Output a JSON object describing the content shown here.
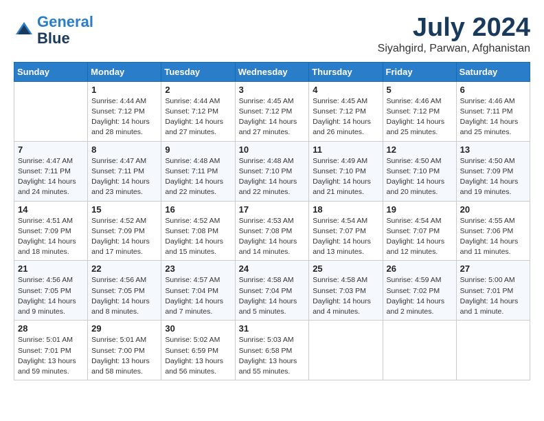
{
  "header": {
    "logo_line1": "General",
    "logo_line2": "Blue",
    "month_year": "July 2024",
    "location": "Siyahgird, Parwan, Afghanistan"
  },
  "weekdays": [
    "Sunday",
    "Monday",
    "Tuesday",
    "Wednesday",
    "Thursday",
    "Friday",
    "Saturday"
  ],
  "weeks": [
    [
      {
        "day": null,
        "info": null
      },
      {
        "day": "1",
        "info": "Sunrise: 4:44 AM\nSunset: 7:12 PM\nDaylight: 14 hours\nand 28 minutes."
      },
      {
        "day": "2",
        "info": "Sunrise: 4:44 AM\nSunset: 7:12 PM\nDaylight: 14 hours\nand 27 minutes."
      },
      {
        "day": "3",
        "info": "Sunrise: 4:45 AM\nSunset: 7:12 PM\nDaylight: 14 hours\nand 27 minutes."
      },
      {
        "day": "4",
        "info": "Sunrise: 4:45 AM\nSunset: 7:12 PM\nDaylight: 14 hours\nand 26 minutes."
      },
      {
        "day": "5",
        "info": "Sunrise: 4:46 AM\nSunset: 7:12 PM\nDaylight: 14 hours\nand 25 minutes."
      },
      {
        "day": "6",
        "info": "Sunrise: 4:46 AM\nSunset: 7:11 PM\nDaylight: 14 hours\nand 25 minutes."
      }
    ],
    [
      {
        "day": "7",
        "info": "Sunrise: 4:47 AM\nSunset: 7:11 PM\nDaylight: 14 hours\nand 24 minutes."
      },
      {
        "day": "8",
        "info": "Sunrise: 4:47 AM\nSunset: 7:11 PM\nDaylight: 14 hours\nand 23 minutes."
      },
      {
        "day": "9",
        "info": "Sunrise: 4:48 AM\nSunset: 7:11 PM\nDaylight: 14 hours\nand 22 minutes."
      },
      {
        "day": "10",
        "info": "Sunrise: 4:48 AM\nSunset: 7:10 PM\nDaylight: 14 hours\nand 22 minutes."
      },
      {
        "day": "11",
        "info": "Sunrise: 4:49 AM\nSunset: 7:10 PM\nDaylight: 14 hours\nand 21 minutes."
      },
      {
        "day": "12",
        "info": "Sunrise: 4:50 AM\nSunset: 7:10 PM\nDaylight: 14 hours\nand 20 minutes."
      },
      {
        "day": "13",
        "info": "Sunrise: 4:50 AM\nSunset: 7:09 PM\nDaylight: 14 hours\nand 19 minutes."
      }
    ],
    [
      {
        "day": "14",
        "info": "Sunrise: 4:51 AM\nSunset: 7:09 PM\nDaylight: 14 hours\nand 18 minutes."
      },
      {
        "day": "15",
        "info": "Sunrise: 4:52 AM\nSunset: 7:09 PM\nDaylight: 14 hours\nand 17 minutes."
      },
      {
        "day": "16",
        "info": "Sunrise: 4:52 AM\nSunset: 7:08 PM\nDaylight: 14 hours\nand 15 minutes."
      },
      {
        "day": "17",
        "info": "Sunrise: 4:53 AM\nSunset: 7:08 PM\nDaylight: 14 hours\nand 14 minutes."
      },
      {
        "day": "18",
        "info": "Sunrise: 4:54 AM\nSunset: 7:07 PM\nDaylight: 14 hours\nand 13 minutes."
      },
      {
        "day": "19",
        "info": "Sunrise: 4:54 AM\nSunset: 7:07 PM\nDaylight: 14 hours\nand 12 minutes."
      },
      {
        "day": "20",
        "info": "Sunrise: 4:55 AM\nSunset: 7:06 PM\nDaylight: 14 hours\nand 11 minutes."
      }
    ],
    [
      {
        "day": "21",
        "info": "Sunrise: 4:56 AM\nSunset: 7:05 PM\nDaylight: 14 hours\nand 9 minutes."
      },
      {
        "day": "22",
        "info": "Sunrise: 4:56 AM\nSunset: 7:05 PM\nDaylight: 14 hours\nand 8 minutes."
      },
      {
        "day": "23",
        "info": "Sunrise: 4:57 AM\nSunset: 7:04 PM\nDaylight: 14 hours\nand 7 minutes."
      },
      {
        "day": "24",
        "info": "Sunrise: 4:58 AM\nSunset: 7:04 PM\nDaylight: 14 hours\nand 5 minutes."
      },
      {
        "day": "25",
        "info": "Sunrise: 4:58 AM\nSunset: 7:03 PM\nDaylight: 14 hours\nand 4 minutes."
      },
      {
        "day": "26",
        "info": "Sunrise: 4:59 AM\nSunset: 7:02 PM\nDaylight: 14 hours\nand 2 minutes."
      },
      {
        "day": "27",
        "info": "Sunrise: 5:00 AM\nSunset: 7:01 PM\nDaylight: 14 hours\nand 1 minute."
      }
    ],
    [
      {
        "day": "28",
        "info": "Sunrise: 5:01 AM\nSunset: 7:01 PM\nDaylight: 13 hours\nand 59 minutes."
      },
      {
        "day": "29",
        "info": "Sunrise: 5:01 AM\nSunset: 7:00 PM\nDaylight: 13 hours\nand 58 minutes."
      },
      {
        "day": "30",
        "info": "Sunrise: 5:02 AM\nSunset: 6:59 PM\nDaylight: 13 hours\nand 56 minutes."
      },
      {
        "day": "31",
        "info": "Sunrise: 5:03 AM\nSunset: 6:58 PM\nDaylight: 13 hours\nand 55 minutes."
      },
      {
        "day": null,
        "info": null
      },
      {
        "day": null,
        "info": null
      },
      {
        "day": null,
        "info": null
      }
    ]
  ]
}
